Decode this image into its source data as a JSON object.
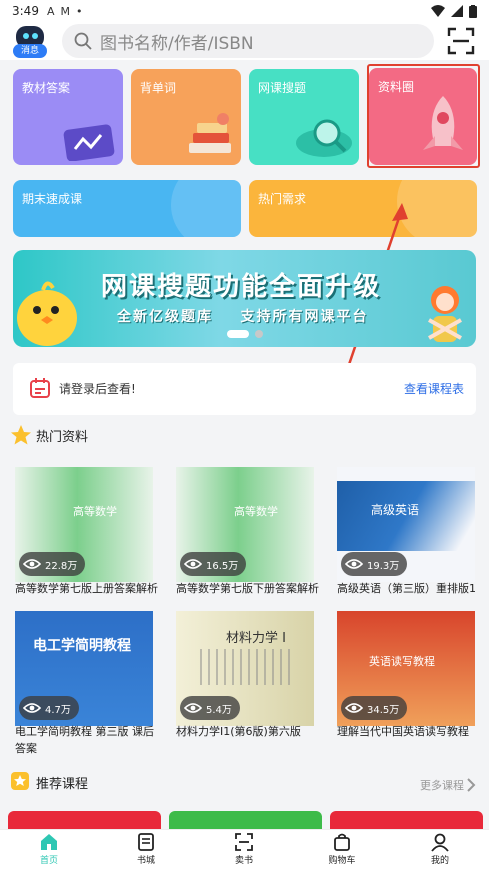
{
  "status_bar": {
    "time": "3:49"
  },
  "header": {
    "logo_badge": "消息",
    "search_placeholder": "图书名称/作者/ISBN"
  },
  "tiles": [
    {
      "label": "教材答案",
      "color": "#9b8cf5"
    },
    {
      "label": "背单词",
      "color": "#f7a25a"
    },
    {
      "label": "网课搜题",
      "color": "#47e0c4"
    },
    {
      "label": "资料圈",
      "color": "#f36a84"
    },
    {
      "label": "期末速成课",
      "color": "#49b6f2"
    },
    {
      "label": "热门需求",
      "color": "#fbb53c"
    }
  ],
  "banner": {
    "title": "网课搜题功能全面升级",
    "subtitle": "全新亿级题库    支持所有网课平台"
  },
  "login": {
    "prompt": "请登录后查看!",
    "link": "查看课程表"
  },
  "hot_section": {
    "title": "热门资料"
  },
  "books": [
    {
      "title": "高等数学第七版上册答案解析",
      "views": "22.8万"
    },
    {
      "title": "高等数学第七版下册答案解析",
      "views": "16.5万"
    },
    {
      "title": "高级英语（第三版）重排版1",
      "views": "19.3万"
    },
    {
      "title": "电工学简明教程 第三版 课后答案",
      "views": "4.7万"
    },
    {
      "title": "材料力学I1(第6版)第六版",
      "views": "5.4万"
    },
    {
      "title": "理解当代中国英语读写教程",
      "views": "34.5万"
    }
  ],
  "recommend_section": {
    "title": "推荐课程",
    "more": "更多课程"
  },
  "tabbar": [
    {
      "label": "首页"
    },
    {
      "label": "书城"
    },
    {
      "label": "卖书"
    },
    {
      "label": "购物车"
    },
    {
      "label": "我的"
    }
  ]
}
